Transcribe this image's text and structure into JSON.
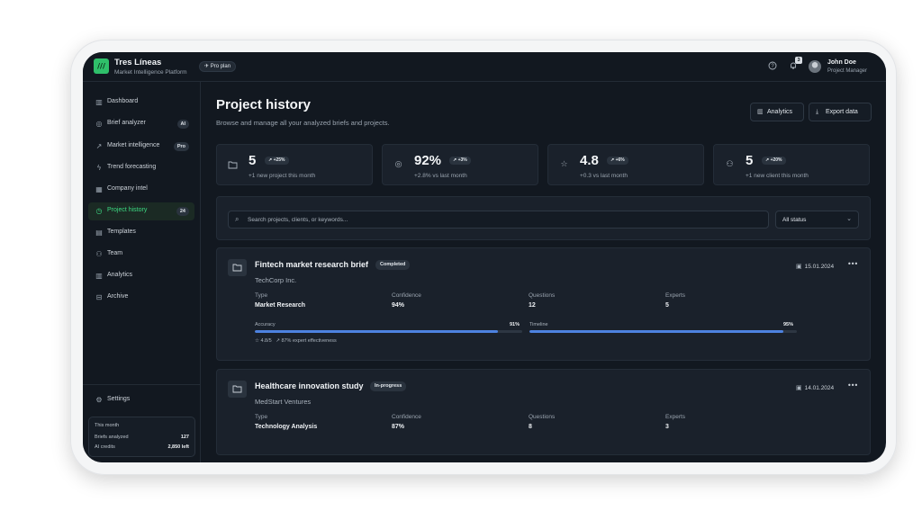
{
  "app": {
    "name": "Tres Líneas",
    "subtitle": "Market Intelligence Platform",
    "logo_text": "///",
    "plan_badge": "✈ Pro plan"
  },
  "header": {
    "notification_count": "3",
    "user_name": "John Doe",
    "user_role": "Project Manager"
  },
  "sidebar": {
    "items": [
      {
        "label": "Dashboard",
        "icon": "bar-chart-icon",
        "badge": ""
      },
      {
        "label": "Brief analyzer",
        "icon": "brain-icon",
        "badge": "AI"
      },
      {
        "label": "Market intelligence",
        "icon": "trend-icon",
        "badge": "Pro"
      },
      {
        "label": "Trend forecasting",
        "icon": "lightning-icon",
        "badge": ""
      },
      {
        "label": "Company intel",
        "icon": "building-icon",
        "badge": ""
      },
      {
        "label": "Project history",
        "icon": "clock-icon",
        "badge": "24",
        "active": true
      },
      {
        "label": "Templates",
        "icon": "document-icon",
        "badge": ""
      },
      {
        "label": "Team",
        "icon": "users-icon",
        "badge": ""
      },
      {
        "label": "Analytics",
        "icon": "bar-chart-icon",
        "badge": ""
      },
      {
        "label": "Archive",
        "icon": "archive-icon",
        "badge": ""
      }
    ],
    "settings_label": "Settings",
    "usage": {
      "title": "This month",
      "rows": [
        {
          "label": "Briefs analyzed",
          "value": "127"
        },
        {
          "label": "AI credits",
          "value": "2,850 left"
        }
      ]
    }
  },
  "page": {
    "title": "Project history",
    "subtitle": "Browse and manage all your analyzed briefs and projects.",
    "analytics_button": "Analytics",
    "export_button": "Export data"
  },
  "stats": [
    {
      "icon": "folder-icon",
      "value": "5",
      "change": "↗ +25%",
      "caption": "+1 new project this month"
    },
    {
      "icon": "target-icon",
      "value": "92%",
      "change": "↗ +3%",
      "caption": "+2.8% vs last month"
    },
    {
      "icon": "star-icon",
      "value": "4.8",
      "change": "↗ +6%",
      "caption": "+0.3 vs last month"
    },
    {
      "icon": "users-icon",
      "value": "5",
      "change": "↗ +20%",
      "caption": "+1 new client this month"
    }
  ],
  "filters": {
    "search_placeholder": "Search projects, clients, or keywords...",
    "status_value": "All status"
  },
  "projects": [
    {
      "title": "Fintech market research brief",
      "status": "Completed",
      "client": "TechCorp Inc.",
      "date": "15.01.2024",
      "meta": [
        {
          "label": "Type",
          "value": "Market Research"
        },
        {
          "label": "Confidence",
          "value": "94%"
        },
        {
          "label": "Questions",
          "value": "12"
        },
        {
          "label": "Experts",
          "value": "5"
        }
      ],
      "bars": [
        {
          "label": "Accuracy",
          "display": "91%",
          "value": 0.91
        },
        {
          "label": "Timeline",
          "display": "95%",
          "value": 0.95
        }
      ],
      "rating": "4.8/5",
      "effectiveness": "87% expert effectiveness"
    },
    {
      "title": "Healthcare innovation study",
      "status": "In-progress",
      "client": "MedStart Ventures",
      "date": "14.01.2024",
      "meta": [
        {
          "label": "Type",
          "value": "Technology Analysis"
        },
        {
          "label": "Confidence",
          "value": "87%"
        },
        {
          "label": "Questions",
          "value": "8"
        },
        {
          "label": "Experts",
          "value": "3"
        }
      ]
    }
  ]
}
